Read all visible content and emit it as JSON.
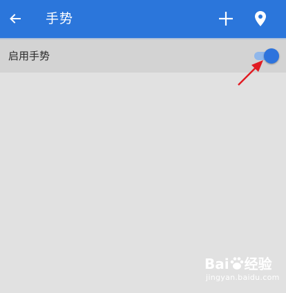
{
  "header": {
    "title": "手势",
    "back_icon": "arrow-left-icon",
    "add_icon": "plus-icon",
    "location_icon": "map-pin-icon",
    "background_color": "#2b76db"
  },
  "settings": {
    "gesture_toggle": {
      "label": "启用手势",
      "enabled": true,
      "accent_color": "#2d73dd"
    }
  },
  "annotation": {
    "arrow_icon": "red-arrow-icon",
    "color": "#e11b22"
  },
  "watermark": {
    "logo": "Baidu经验",
    "url": "jingyan.baidu.com"
  }
}
